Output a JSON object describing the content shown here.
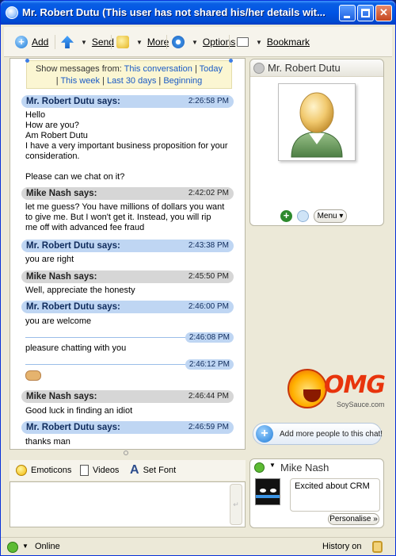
{
  "window": {
    "title": "Mr. Robert Dutu (This user has not shared his/her details wit..."
  },
  "toolbar": {
    "add_label": "Add",
    "send_label": "Send",
    "more_label": "More",
    "options_label": "Options",
    "bookmark_label": "Bookmark"
  },
  "history": {
    "prefix": "Show messages from:",
    "this_conversation": "This conversation",
    "today": "Today",
    "this_week": "This week",
    "last_30_days": "Last 30 days",
    "beginning": "Beginning",
    "sep": "|"
  },
  "messages": [
    {
      "sender": "Mr. Robert Dutu says:",
      "time": "2:26:58 PM",
      "lines": [
        "Hello",
        "How are you?",
        "Am Robert Dutu",
        "I have a very important business proposition for your",
        "consideration.",
        "",
        "Please can we chat on it?"
      ]
    },
    {
      "sender": "Mike Nash says:",
      "time": "2:42:02 PM",
      "lines": [
        "let me guess?  You have millions of dollars you want",
        "to give me.  But I won't get it.  Instead, you will rip",
        "me off with advanced fee fraud"
      ]
    },
    {
      "sender": "Mr. Robert Dutu says:",
      "time": "2:43:38 PM",
      "lines": [
        "you are right"
      ]
    },
    {
      "sender": "Mike Nash says:",
      "time": "2:45:50 PM",
      "lines": [
        "Well, appreciate the honesty"
      ]
    },
    {
      "sender": "Mr. Robert Dutu says:",
      "time": "2:46:00 PM",
      "lines": [
        "you are welcome"
      ]
    },
    {
      "time": "2:46:08 PM",
      "lines": [
        "pleasure chatting with you"
      ]
    },
    {
      "time": "2:46:12 PM",
      "lines": []
    },
    {
      "sender": "Mike Nash says:",
      "time": "2:46:44 PM",
      "lines": [
        "Good luck in finding an idiot"
      ]
    },
    {
      "sender": "Mr. Robert Dutu says:",
      "time": "2:46:59 PM",
      "lines": [
        "thanks man"
      ]
    }
  ],
  "formatbar": {
    "emoticons": "Emoticons",
    "videos": "Videos",
    "set_font": "Set Font"
  },
  "input": {
    "value": "",
    "send_glyph": "↵"
  },
  "contact": {
    "name": "Mr. Robert Dutu",
    "add_glyph": "+",
    "menu_label": "Menu ▾"
  },
  "promo": {
    "wordmark": "OMG",
    "sub": "SoySauce.com",
    "add_people_label": "Add more people to this chat!"
  },
  "me": {
    "name": "Mike Nash",
    "personal_message": "Excited about CRM",
    "personalise_label": "Personalise »"
  },
  "status": {
    "presence": "Online",
    "history_label": "History on"
  },
  "colors": {
    "title_blue": "#0055e5",
    "remote_header": "#bfd6f3",
    "local_header": "#d6d6d6",
    "link": "#1a5bc5",
    "online_green": "#5dbb34"
  }
}
